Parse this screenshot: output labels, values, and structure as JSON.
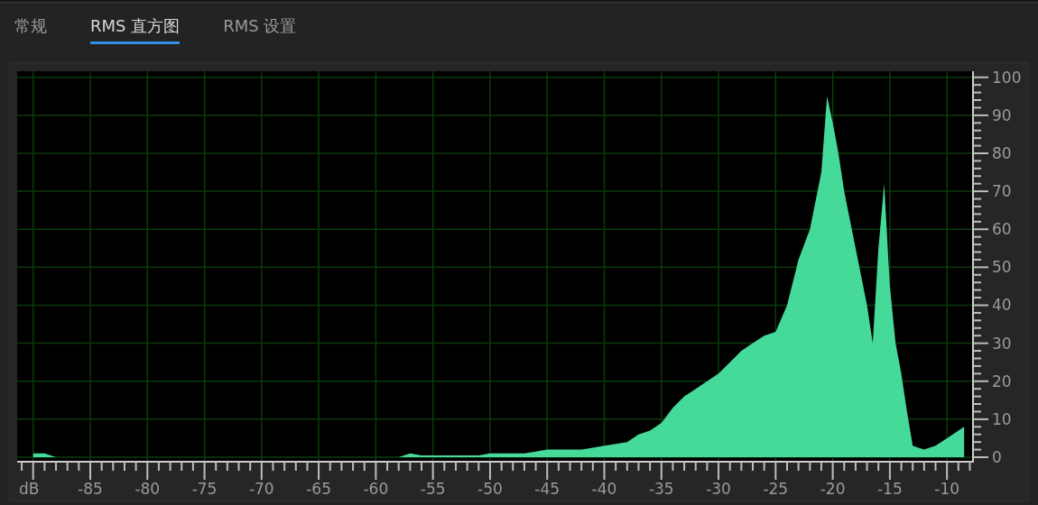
{
  "tabs": [
    {
      "label": "常规",
      "selected": false
    },
    {
      "label": "RMS 直方图",
      "selected": true
    },
    {
      "label": "RMS 设置",
      "selected": false
    }
  ],
  "histogram": {
    "chart_data": {
      "type": "area",
      "xlabel": "dB",
      "x": [
        -90,
        -89,
        -88,
        -87,
        -86,
        -85,
        -84,
        -83,
        -82,
        -81,
        -80,
        -79,
        -78,
        -77,
        -76,
        -75,
        -74,
        -73,
        -72,
        -71,
        -70,
        -69,
        -68,
        -67,
        -66,
        -65,
        -64,
        -63,
        -62,
        -61,
        -60,
        -59,
        -58,
        -57,
        -56,
        -55,
        -54,
        -53,
        -52,
        -51,
        -50,
        -49,
        -48,
        -47,
        -46,
        -45,
        -44,
        -43,
        -42,
        -41,
        -40,
        -39,
        -38,
        -37,
        -36,
        -35,
        -34,
        -33,
        -32,
        -31,
        -30,
        -29,
        -28,
        -27,
        -26,
        -25,
        -24,
        -23,
        -22,
        -21,
        -20.5,
        -20,
        -19.5,
        -19,
        -18,
        -17,
        -16.5,
        -16,
        -15.5,
        -15,
        -14.5,
        -14,
        -13.5,
        -13,
        -12,
        -11,
        -10,
        -9,
        -8.5
      ],
      "grid": true,
      "series": [
        {
          "color": "#45d99a",
          "values": [
            1,
            1,
            0,
            0,
            0,
            0,
            0,
            0,
            0,
            0,
            0,
            0,
            0,
            0,
            0,
            0,
            0,
            0,
            0,
            0,
            0,
            0,
            0,
            0,
            0,
            0,
            0,
            0,
            0,
            0,
            0,
            0,
            0,
            1,
            0.5,
            0.5,
            0.5,
            0.5,
            0.5,
            0.5,
            1,
            1,
            1,
            1,
            1.5,
            2,
            2,
            2,
            2,
            2.5,
            3,
            3.5,
            4,
            6,
            7,
            9,
            13,
            16,
            18,
            20,
            22,
            25,
            28,
            30,
            32,
            33,
            40,
            52,
            60,
            75,
            95,
            88,
            80,
            70,
            55,
            40,
            30,
            55,
            72,
            45,
            30,
            22,
            12,
            3,
            2,
            3,
            5,
            7,
            8
          ]
        }
      ],
      "xlim": [
        -91.4,
        -7.8
      ],
      "ylim": [
        0,
        101.6
      ],
      "xticks": [
        -85,
        -80,
        -75,
        -70,
        -65,
        -60,
        -55,
        -50,
        -45,
        -40,
        -35,
        -30,
        -25,
        -20,
        -15,
        -10
      ],
      "yticks": [
        0,
        10,
        20,
        30,
        40,
        50,
        60,
        70,
        80,
        90,
        100
      ]
    }
  }
}
